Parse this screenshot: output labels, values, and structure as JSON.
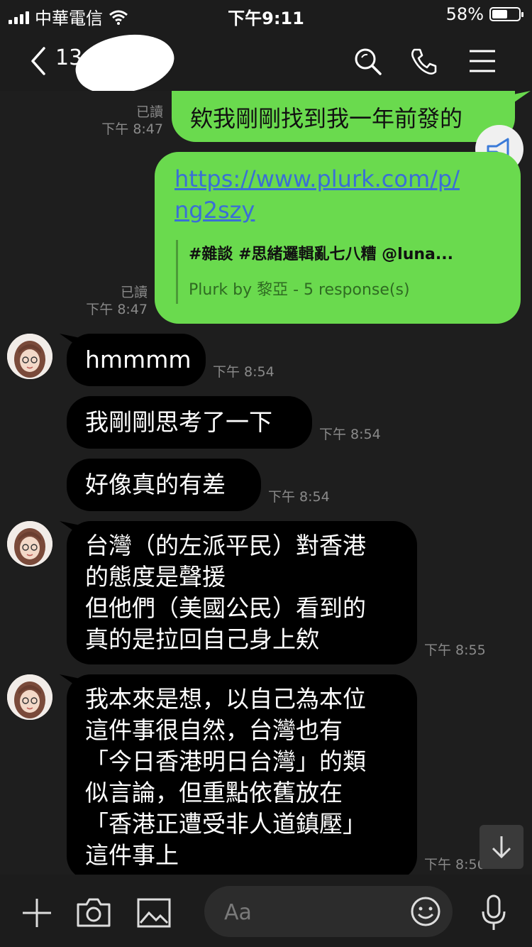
{
  "status_bar": {
    "carrier": "中華電信",
    "time": "下午9:11",
    "battery": "58%",
    "battery_level": 0.58
  },
  "header": {
    "title": "13"
  },
  "messages": [
    {
      "direction": "out",
      "text": "欸我剛剛找到我一年前發的",
      "read": "已讀",
      "time": "下午 8:47"
    },
    {
      "direction": "out",
      "link": "https://www.plurk.com/p/ng2szy",
      "link_line1": "https://www.plurk.com/p/",
      "link_line2": "ng2szy",
      "preview_title": "#雜談 #思緒邏輯亂七八糟 @luna...",
      "preview_subtitle": "Plurk by 黎亞 - 5 response(s)",
      "read": "已讀",
      "time": "下午 8:47"
    },
    {
      "direction": "in",
      "text": "hmmmm",
      "time": "下午 8:54"
    },
    {
      "direction": "in",
      "text": "我剛剛思考了一下",
      "time": "下午 8:54"
    },
    {
      "direction": "in",
      "text": "好像真的有差",
      "time": "下午 8:54"
    },
    {
      "direction": "in",
      "lines": [
        "台灣（的左派平民）對香港",
        "的態度是聲援",
        "但他們（美國公民）看到的",
        "真的是拉回自己身上欸"
      ],
      "time": "下午 8:55"
    },
    {
      "direction": "in",
      "lines": [
        "我本來是想，以自己為本位",
        "這件事很自然，台灣也有",
        "「今日香港明日台灣」的類",
        "似言論，但重點依舊放在",
        "「香港正遭受非人道鎮壓」",
        "這件事上"
      ],
      "time": "下午 8:56"
    }
  ],
  "composer": {
    "placeholder": "Aa"
  },
  "icons": {
    "header": [
      "back-chevron-icon",
      "search-icon",
      "phone-icon",
      "menu-icon"
    ],
    "bottom": [
      "plus-icon",
      "camera-icon",
      "image-icon",
      "emoji-icon",
      "mic-icon"
    ],
    "overlay": [
      "announcement-icon",
      "scroll-down-icon"
    ]
  },
  "colors": {
    "outgoing_bubble": "#6ada4e",
    "incoming_bubble": "#000000",
    "background": "#1e1e1e",
    "link": "#3a6fd6"
  }
}
